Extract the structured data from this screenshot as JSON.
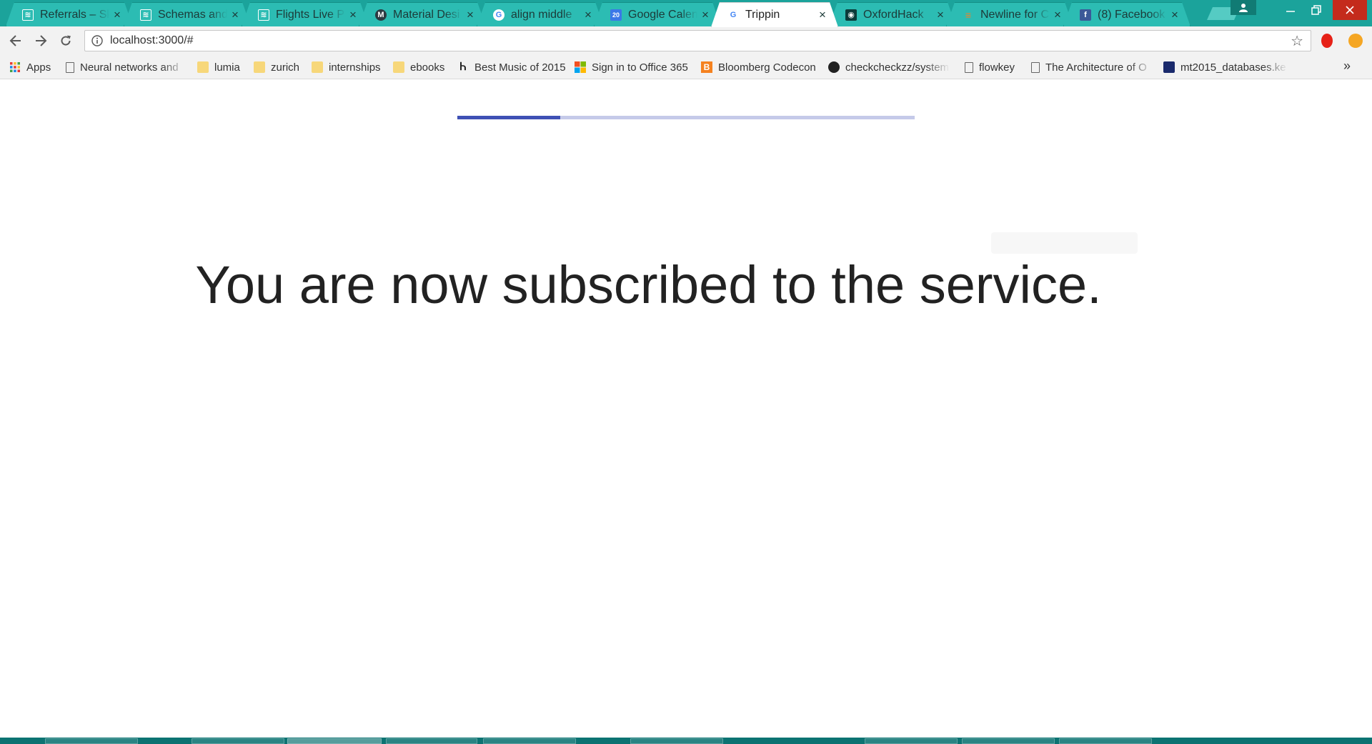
{
  "browser": {
    "tabs": [
      {
        "title": "Referrals – Sk",
        "favicon": "skyscanner-icon",
        "color": "#2cbcb3"
      },
      {
        "title": "Schemas and",
        "favicon": "skyscanner-icon",
        "color": "#2cbcb3"
      },
      {
        "title": "Flights Live Pr",
        "favicon": "skyscanner-icon",
        "color": "#2cbcb3"
      },
      {
        "title": "Material Desi",
        "favicon": "material-icon",
        "color": "#2b3a42"
      },
      {
        "title": "align middle",
        "favicon": "google-icon",
        "color": "#4285f4"
      },
      {
        "title": "Google Calen",
        "favicon": "calendar-icon",
        "color": "#3b78e7"
      },
      {
        "title": "Trippin",
        "favicon": "google-icon",
        "color": "#4285f4",
        "active": true
      },
      {
        "title": "OxfordHack",
        "favicon": "oxfordhack-icon",
        "color": "#0b3b3a"
      },
      {
        "title": "Newline for C",
        "favicon": "stackoverflow-icon",
        "color": "#f48024"
      },
      {
        "title": "(8) Facebook",
        "favicon": "facebook-icon",
        "color": "#3b5998"
      }
    ],
    "address": "localhost:3000/#",
    "bookmarks": [
      {
        "label": "Apps",
        "icon": "apps-grid-icon"
      },
      {
        "label": "Neural networks and",
        "icon": "page-icon"
      },
      {
        "label": "lumia",
        "icon": "folder-icon"
      },
      {
        "label": "zurich",
        "icon": "folder-icon"
      },
      {
        "label": "internships",
        "icon": "folder-icon"
      },
      {
        "label": "ebooks",
        "icon": "folder-icon"
      },
      {
        "label": "Best Music of 2015",
        "icon": "music-icon"
      },
      {
        "label": "Sign in to Office 365",
        "icon": "office-icon"
      },
      {
        "label": "Bloomberg Codecon",
        "icon": "bloomberg-icon"
      },
      {
        "label": "checkcheckzz/system",
        "icon": "github-icon"
      },
      {
        "label": "flowkey",
        "icon": "page-icon"
      },
      {
        "label": "The Architecture of O",
        "icon": "page-icon"
      },
      {
        "label": "mt2015_databases.ke",
        "icon": "keynote-icon"
      }
    ],
    "more_bookmarks": "»"
  },
  "page": {
    "progress_fraction": 0.225,
    "headline": "You are now subscribed to the service."
  },
  "colors": {
    "tabstrip": "#1ba39b",
    "progress_fill": "#3f51b5",
    "progress_track": "#c5cae9",
    "taskbar": "#0c7372"
  }
}
